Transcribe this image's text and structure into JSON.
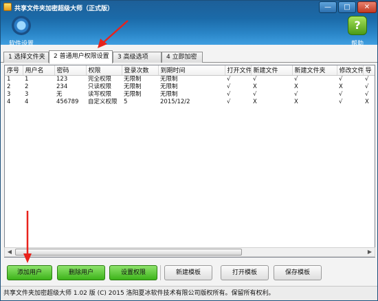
{
  "window": {
    "title": "共享文件夹加密超级大师（正式版）",
    "minimize_glyph": "—",
    "maximize_glyph": "□",
    "close_glyph": "✕"
  },
  "toolbar": {
    "settings_label": "软件设置",
    "settings_icon": "gear-icon",
    "help_label": "帮助",
    "help_icon": "help-icon",
    "help_glyph": "?"
  },
  "tabs": [
    {
      "label": "1 选择文件夹",
      "active": false
    },
    {
      "label": "2 普通用户权限设置",
      "active": true
    },
    {
      "label": "3 高级选项",
      "active": false
    },
    {
      "label": "4 立即加密",
      "active": false
    }
  ],
  "table": {
    "columns": [
      "序号",
      "用户名",
      "密码",
      "权限",
      "登录次数",
      "到期时间",
      "打开文件",
      "新建文件",
      "新建文件夹",
      "修改文件",
      "导"
    ],
    "rows": [
      [
        "1",
        "1",
        "123",
        "完全权限",
        "无限制",
        "无限制",
        "√",
        "√",
        "√",
        "√",
        "√"
      ],
      [
        "2",
        "2",
        "234",
        "只读权限",
        "无限制",
        "无限制",
        "√",
        "X",
        "X",
        "X",
        "√"
      ],
      [
        "3",
        "3",
        "无",
        "读写权限",
        "无限制",
        "无限制",
        "√",
        "√",
        "√",
        "√",
        "√"
      ],
      [
        "4",
        "4",
        "456789",
        "自定义权限",
        "5",
        "2015/12/2",
        "√",
        "X",
        "X",
        "√",
        "X"
      ]
    ]
  },
  "scrollbar": {
    "left_glyph": "◀",
    "right_glyph": "▶"
  },
  "buttons": {
    "add_user": "添加用户",
    "delete_user": "删除用户",
    "set_permission": "设置权限",
    "new_template": "新建模板",
    "open_template": "打开模板",
    "save_template": "保存模板"
  },
  "status": {
    "text": "共享文件夹加密超级大师 1.02 版  (C) 2015 洛阳夏冰软件技术有限公司版权所有。保留所有权利。"
  },
  "colors": {
    "title_gradient_top": "#1d5f98",
    "title_gradient_bottom": "#3f9ee0",
    "green_button": "#3db31a",
    "annotation_arrow": "#e8221b"
  }
}
